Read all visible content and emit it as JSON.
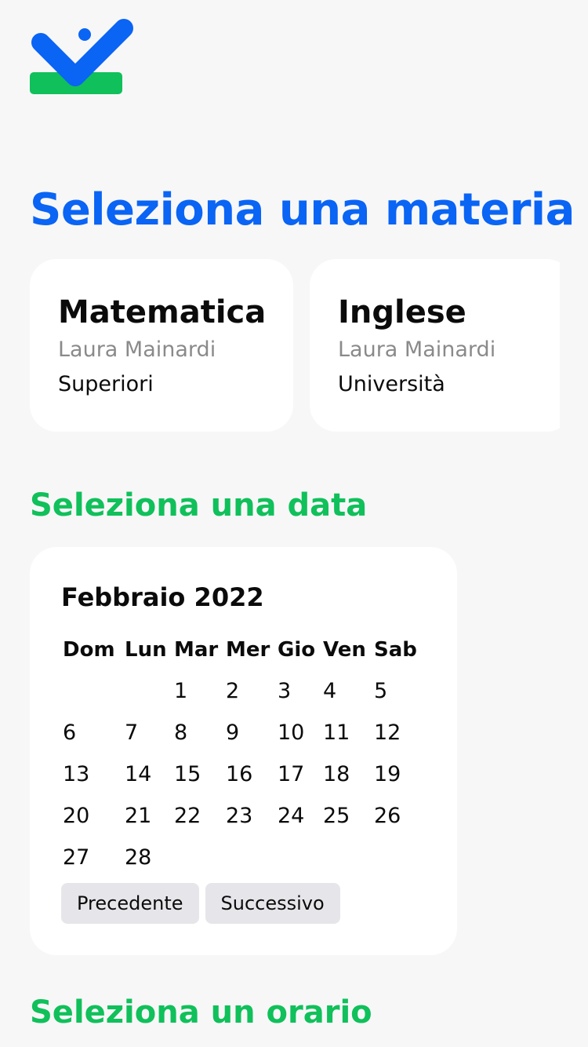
{
  "logo": {
    "icon": "checkmark-logo-icon",
    "colors": {
      "check": "#0a64f4",
      "bar": "#10c05a"
    }
  },
  "subject_section": {
    "title": "Seleziona una materia",
    "subjects": [
      {
        "name": "Matematica",
        "teacher": "Laura Mainardi",
        "level": "Superiori"
      },
      {
        "name": "Inglese",
        "teacher": "Laura Mainardi",
        "level": "Università"
      }
    ]
  },
  "date_section": {
    "title": "Seleziona una data",
    "calendar": {
      "month_label": "Febbraio 2022",
      "weekdays": [
        "Dom",
        "Lun",
        "Mar",
        "Mer",
        "Gio",
        "Ven",
        "Sab"
      ],
      "weeks": [
        [
          "",
          "",
          "1",
          "2",
          "3",
          "4",
          "5"
        ],
        [
          "6",
          "7",
          "8",
          "9",
          "10",
          "11",
          "12"
        ],
        [
          "13",
          "14",
          "15",
          "16",
          "17",
          "18",
          "19"
        ],
        [
          "20",
          "21",
          "22",
          "23",
          "24",
          "25",
          "26"
        ],
        [
          "27",
          "28",
          "",
          "",
          "",
          "",
          ""
        ]
      ],
      "prev_label": "Precedente",
      "next_label": "Successivo"
    }
  },
  "time_section": {
    "title": "Seleziona un orario"
  },
  "colors": {
    "primary_blue": "#0a64f4",
    "accent_green": "#10c05a",
    "background": "#f7f7f8"
  }
}
